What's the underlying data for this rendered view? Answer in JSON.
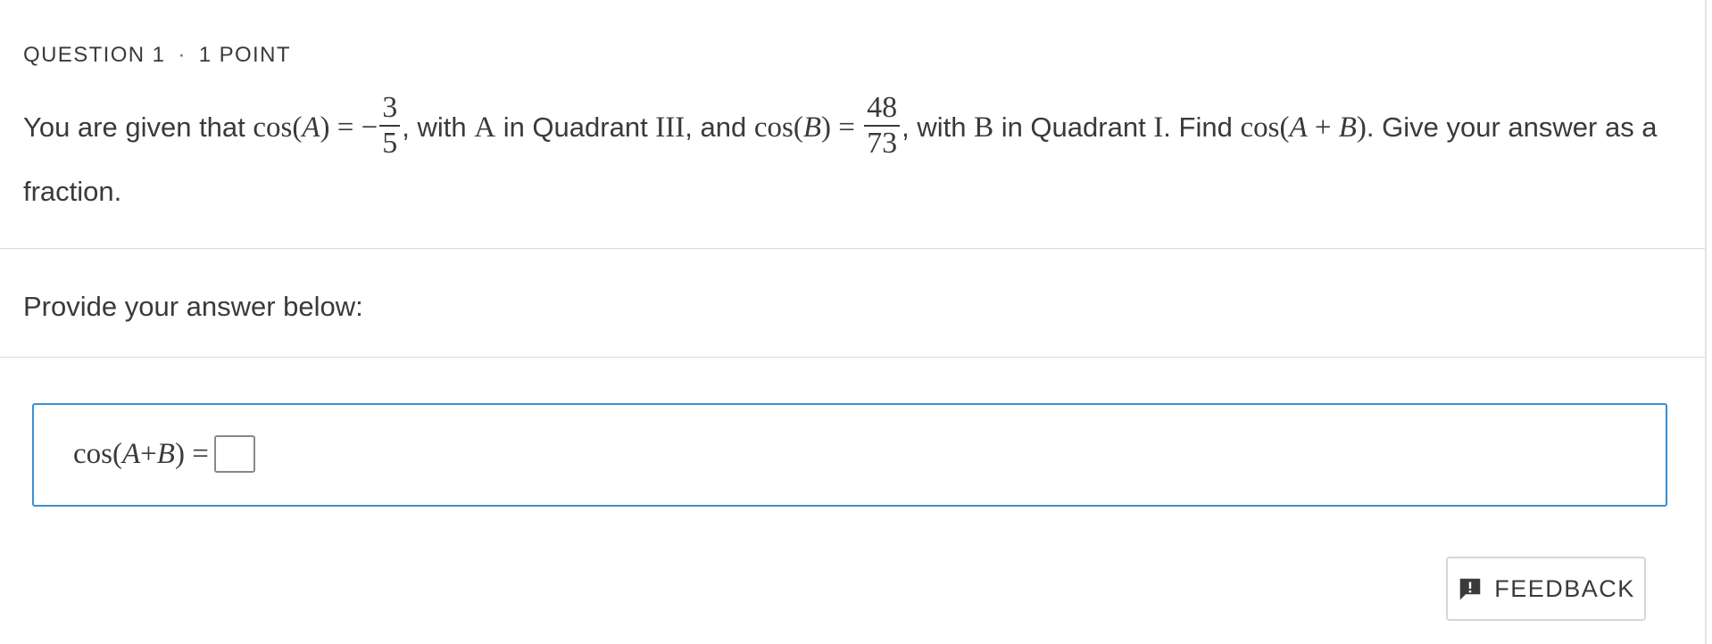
{
  "question": {
    "number_label": "QUESTION 1",
    "separator": "·",
    "points_label": "1 POINT",
    "text_1": "You are given that ",
    "cosA_lhs": "cos(",
    "var_A": "A",
    "rparen_eq": ") = −",
    "fracA_num": "3",
    "fracA_den": "5",
    "text_2": ", with ",
    "text_3": " in Quadrant ",
    "quadrant_A": "III",
    "text_4": ", and ",
    "cosB_lhs": "cos(",
    "var_B": "B",
    "rparen_eq_B": ") = ",
    "fracB_num": "48",
    "fracB_den": "73",
    "text_5": ", with ",
    "text_6": " in Quadrant ",
    "quadrant_B": "I",
    "text_7": ". Find ",
    "cosAB_lhs": "cos(",
    "plus": " + ",
    "rparen_end": ")",
    "text_8": ". Give your answer as a fraction."
  },
  "prompt": "Provide your answer below:",
  "answer": {
    "cos": "cos",
    "lparen": " (",
    "var_A": "A",
    "plus": " + ",
    "var_B": "B",
    "rparen_eq": ") ="
  },
  "feedback_button": {
    "label": "FEEDBACK",
    "icon": "feedback-icon"
  },
  "colors": {
    "accent": "#3b8fd0",
    "text": "#3a3a3a",
    "divider": "#d9d9d9"
  }
}
